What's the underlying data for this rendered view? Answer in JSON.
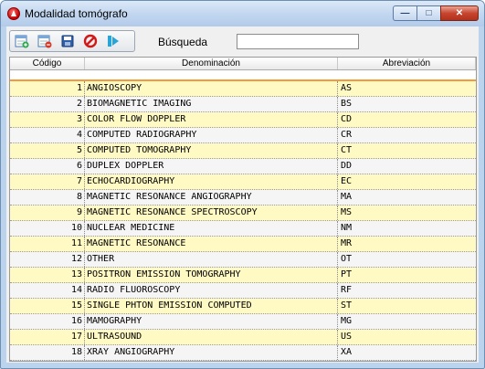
{
  "window": {
    "title": "Modalidad tomógrafo"
  },
  "toolbar": {
    "buttons": [
      {
        "name": "add-icon"
      },
      {
        "name": "delete-icon"
      },
      {
        "name": "save-icon"
      },
      {
        "name": "cancel-icon"
      },
      {
        "name": "exit-icon"
      }
    ]
  },
  "search": {
    "label": "Búsqueda",
    "value": ""
  },
  "grid": {
    "columns": [
      "Código",
      "Denominación",
      "Abreviación"
    ],
    "rows": [
      {
        "code": "1",
        "name": "ANGIOSCOPY",
        "abbr": "AS"
      },
      {
        "code": "2",
        "name": "BIOMAGNETIC IMAGING",
        "abbr": "BS"
      },
      {
        "code": "3",
        "name": "COLOR FLOW DOPPLER",
        "abbr": "CD"
      },
      {
        "code": "4",
        "name": "COMPUTED RADIOGRAPHY",
        "abbr": "CR"
      },
      {
        "code": "5",
        "name": "COMPUTED TOMOGRAPHY",
        "abbr": "CT"
      },
      {
        "code": "6",
        "name": "DUPLEX DOPPLER",
        "abbr": "DD"
      },
      {
        "code": "7",
        "name": "ECHOCARDIOGRAPHY",
        "abbr": "EC"
      },
      {
        "code": "8",
        "name": "MAGNETIC RESONANCE ANGIOGRAPHY",
        "abbr": "MA"
      },
      {
        "code": "9",
        "name": "MAGNETIC RESONANCE SPECTROSCOPY",
        "abbr": "MS"
      },
      {
        "code": "10",
        "name": "NUCLEAR MEDICINE",
        "abbr": "NM"
      },
      {
        "code": "11",
        "name": "MAGNETIC RESONANCE",
        "abbr": "MR"
      },
      {
        "code": "12",
        "name": "OTHER",
        "abbr": "OT"
      },
      {
        "code": "13",
        "name": "POSITRON EMISSION TOMOGRAPHY",
        "abbr": "PT"
      },
      {
        "code": "14",
        "name": "RADIO FLUOROSCOPY",
        "abbr": "RF"
      },
      {
        "code": "15",
        "name": "SINGLE PHTON EMISSION COMPUTED",
        "abbr": "ST"
      },
      {
        "code": "16",
        "name": "MAMOGRAPHY",
        "abbr": "MG"
      },
      {
        "code": "17",
        "name": "ULTRASOUND",
        "abbr": "US"
      },
      {
        "code": "18",
        "name": "XRAY ANGIOGRAPHY",
        "abbr": "XA"
      }
    ]
  },
  "colors": {
    "row_odd": "#fff9c4",
    "row_even": "#f5f5f5",
    "accent": "#f29a3c"
  }
}
